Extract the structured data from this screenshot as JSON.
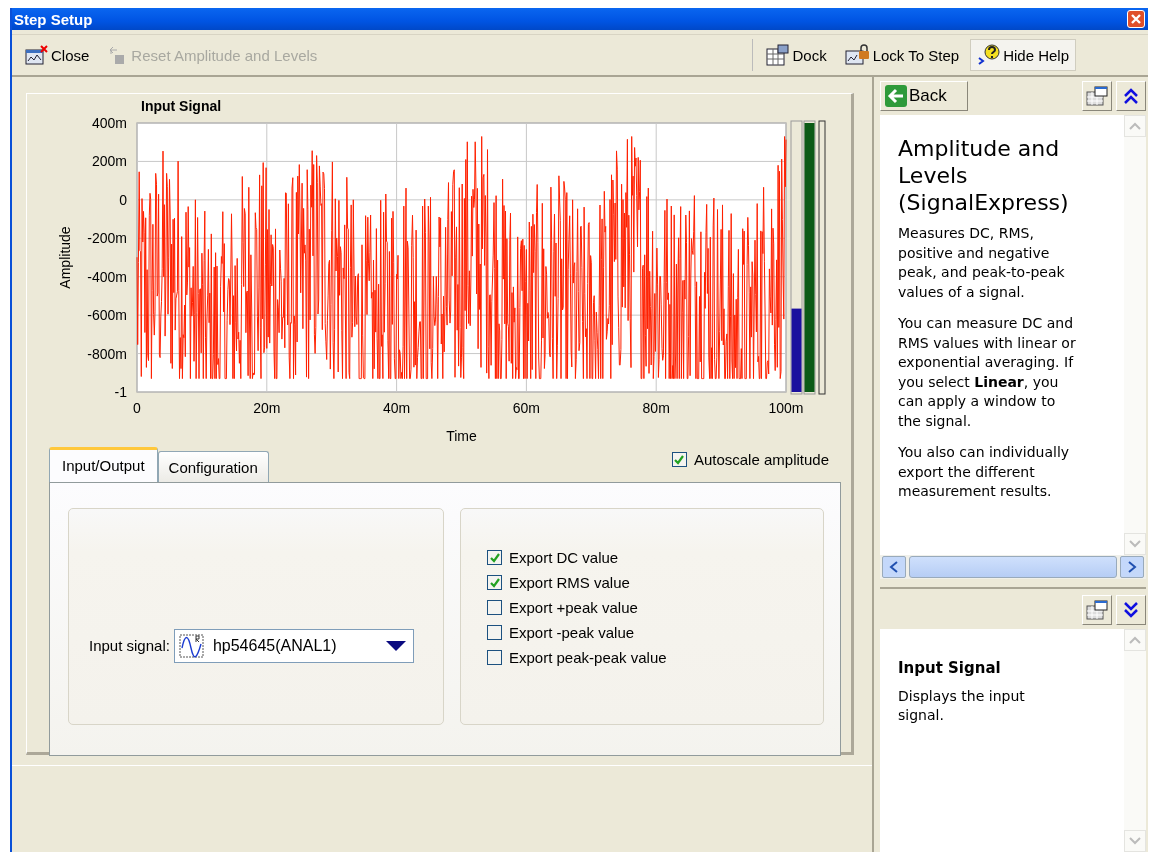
{
  "window": {
    "title": "Step Setup"
  },
  "toolbar": {
    "left": [
      {
        "kind": "close",
        "label": "Close",
        "disabled": false
      },
      {
        "kind": "reset",
        "label": "Reset Amplitude and Levels",
        "disabled": true
      }
    ],
    "right": [
      {
        "kind": "dock",
        "label": "Dock",
        "selected": false
      },
      {
        "kind": "lock",
        "label": "Lock To Step",
        "selected": false
      },
      {
        "kind": "help",
        "label": "Hide Help",
        "selected": true
      }
    ]
  },
  "graph": {
    "title": "Input Signal",
    "xlabel": "Time",
    "ylabel": "Amplitude",
    "yticks": [
      "400m",
      "200m",
      "0",
      "-200m",
      "-400m",
      "-600m",
      "-800m",
      "-1"
    ],
    "xticks": [
      "0",
      "20m",
      "40m",
      "60m",
      "80m",
      "100m"
    ]
  },
  "meters": [
    {
      "level": 0.31,
      "color": "#1a0f9e"
    },
    {
      "level": 1,
      "color": "#0b5a16"
    }
  ],
  "autoscale": {
    "label": "Autoscale amplitude",
    "checked": true
  },
  "tabs": [
    {
      "label": "Input/Output",
      "selected": true
    },
    {
      "label": "Configuration",
      "selected": false
    }
  ],
  "input_signal": {
    "label": "Input signal:",
    "value": "hp54645(ANAL1)"
  },
  "exports": [
    {
      "label": "Export DC value",
      "checked": true
    },
    {
      "label": "Export RMS value",
      "checked": true
    },
    {
      "label": "Export +peak value",
      "checked": false
    },
    {
      "label": "Export -peak value",
      "checked": false
    },
    {
      "label": "Export peak-peak value",
      "checked": false
    }
  ],
  "help": {
    "back": "Back",
    "heading": "Amplitude and Levels (SignalExpress)",
    "paragraphs": [
      "Measures DC, RMS, positive and negative peak, and peak-to-peak values of a signal.",
      "You can measure DC and RMS values with linear or exponential averaging. If you select **Linear**, you can apply a window to the signal.",
      "You also can individually export the different measurement results."
    ]
  },
  "context_help": {
    "heading": "Input Signal",
    "text": "Displays the input signal."
  }
}
